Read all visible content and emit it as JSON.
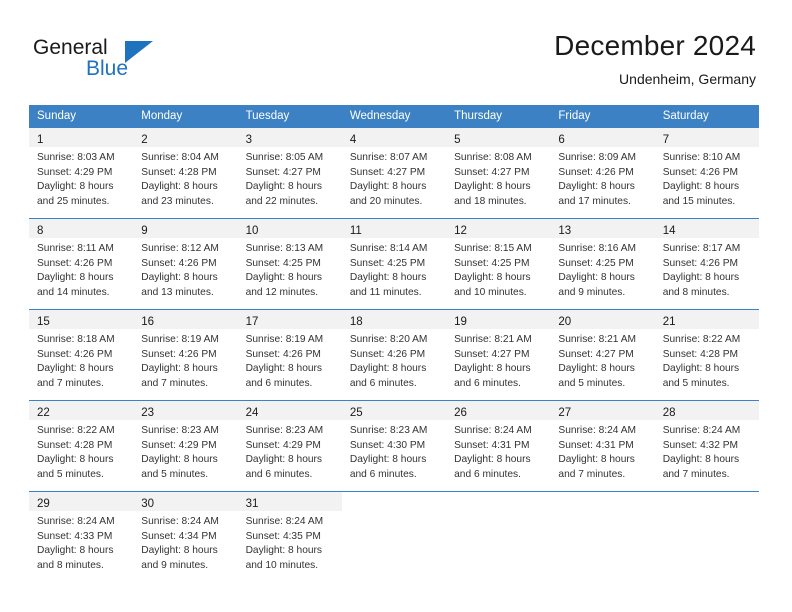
{
  "brand": {
    "name_part1": "General",
    "name_part2": "Blue",
    "accent_color": "#1f72bd"
  },
  "header": {
    "title": "December 2024",
    "location": "Undenheim, Germany"
  },
  "theme": {
    "header_row_color": "#3c81c4",
    "daynum_band_color": "#f2f2f2",
    "separator_color": "#3c81c4"
  },
  "weekday_headers": [
    "Sunday",
    "Monday",
    "Tuesday",
    "Wednesday",
    "Thursday",
    "Friday",
    "Saturday"
  ],
  "weeks": [
    [
      {
        "day": "1",
        "sunrise": "Sunrise: 8:03 AM",
        "sunset": "Sunset: 4:29 PM",
        "daylight1": "Daylight: 8 hours",
        "daylight2": "and 25 minutes."
      },
      {
        "day": "2",
        "sunrise": "Sunrise: 8:04 AM",
        "sunset": "Sunset: 4:28 PM",
        "daylight1": "Daylight: 8 hours",
        "daylight2": "and 23 minutes."
      },
      {
        "day": "3",
        "sunrise": "Sunrise: 8:05 AM",
        "sunset": "Sunset: 4:27 PM",
        "daylight1": "Daylight: 8 hours",
        "daylight2": "and 22 minutes."
      },
      {
        "day": "4",
        "sunrise": "Sunrise: 8:07 AM",
        "sunset": "Sunset: 4:27 PM",
        "daylight1": "Daylight: 8 hours",
        "daylight2": "and 20 minutes."
      },
      {
        "day": "5",
        "sunrise": "Sunrise: 8:08 AM",
        "sunset": "Sunset: 4:27 PM",
        "daylight1": "Daylight: 8 hours",
        "daylight2": "and 18 minutes."
      },
      {
        "day": "6",
        "sunrise": "Sunrise: 8:09 AM",
        "sunset": "Sunset: 4:26 PM",
        "daylight1": "Daylight: 8 hours",
        "daylight2": "and 17 minutes."
      },
      {
        "day": "7",
        "sunrise": "Sunrise: 8:10 AM",
        "sunset": "Sunset: 4:26 PM",
        "daylight1": "Daylight: 8 hours",
        "daylight2": "and 15 minutes."
      }
    ],
    [
      {
        "day": "8",
        "sunrise": "Sunrise: 8:11 AM",
        "sunset": "Sunset: 4:26 PM",
        "daylight1": "Daylight: 8 hours",
        "daylight2": "and 14 minutes."
      },
      {
        "day": "9",
        "sunrise": "Sunrise: 8:12 AM",
        "sunset": "Sunset: 4:26 PM",
        "daylight1": "Daylight: 8 hours",
        "daylight2": "and 13 minutes."
      },
      {
        "day": "10",
        "sunrise": "Sunrise: 8:13 AM",
        "sunset": "Sunset: 4:25 PM",
        "daylight1": "Daylight: 8 hours",
        "daylight2": "and 12 minutes."
      },
      {
        "day": "11",
        "sunrise": "Sunrise: 8:14 AM",
        "sunset": "Sunset: 4:25 PM",
        "daylight1": "Daylight: 8 hours",
        "daylight2": "and 11 minutes."
      },
      {
        "day": "12",
        "sunrise": "Sunrise: 8:15 AM",
        "sunset": "Sunset: 4:25 PM",
        "daylight1": "Daylight: 8 hours",
        "daylight2": "and 10 minutes."
      },
      {
        "day": "13",
        "sunrise": "Sunrise: 8:16 AM",
        "sunset": "Sunset: 4:25 PM",
        "daylight1": "Daylight: 8 hours",
        "daylight2": "and 9 minutes."
      },
      {
        "day": "14",
        "sunrise": "Sunrise: 8:17 AM",
        "sunset": "Sunset: 4:26 PM",
        "daylight1": "Daylight: 8 hours",
        "daylight2": "and 8 minutes."
      }
    ],
    [
      {
        "day": "15",
        "sunrise": "Sunrise: 8:18 AM",
        "sunset": "Sunset: 4:26 PM",
        "daylight1": "Daylight: 8 hours",
        "daylight2": "and 7 minutes."
      },
      {
        "day": "16",
        "sunrise": "Sunrise: 8:19 AM",
        "sunset": "Sunset: 4:26 PM",
        "daylight1": "Daylight: 8 hours",
        "daylight2": "and 7 minutes."
      },
      {
        "day": "17",
        "sunrise": "Sunrise: 8:19 AM",
        "sunset": "Sunset: 4:26 PM",
        "daylight1": "Daylight: 8 hours",
        "daylight2": "and 6 minutes."
      },
      {
        "day": "18",
        "sunrise": "Sunrise: 8:20 AM",
        "sunset": "Sunset: 4:26 PM",
        "daylight1": "Daylight: 8 hours",
        "daylight2": "and 6 minutes."
      },
      {
        "day": "19",
        "sunrise": "Sunrise: 8:21 AM",
        "sunset": "Sunset: 4:27 PM",
        "daylight1": "Daylight: 8 hours",
        "daylight2": "and 6 minutes."
      },
      {
        "day": "20",
        "sunrise": "Sunrise: 8:21 AM",
        "sunset": "Sunset: 4:27 PM",
        "daylight1": "Daylight: 8 hours",
        "daylight2": "and 5 minutes."
      },
      {
        "day": "21",
        "sunrise": "Sunrise: 8:22 AM",
        "sunset": "Sunset: 4:28 PM",
        "daylight1": "Daylight: 8 hours",
        "daylight2": "and 5 minutes."
      }
    ],
    [
      {
        "day": "22",
        "sunrise": "Sunrise: 8:22 AM",
        "sunset": "Sunset: 4:28 PM",
        "daylight1": "Daylight: 8 hours",
        "daylight2": "and 5 minutes."
      },
      {
        "day": "23",
        "sunrise": "Sunrise: 8:23 AM",
        "sunset": "Sunset: 4:29 PM",
        "daylight1": "Daylight: 8 hours",
        "daylight2": "and 5 minutes."
      },
      {
        "day": "24",
        "sunrise": "Sunrise: 8:23 AM",
        "sunset": "Sunset: 4:29 PM",
        "daylight1": "Daylight: 8 hours",
        "daylight2": "and 6 minutes."
      },
      {
        "day": "25",
        "sunrise": "Sunrise: 8:23 AM",
        "sunset": "Sunset: 4:30 PM",
        "daylight1": "Daylight: 8 hours",
        "daylight2": "and 6 minutes."
      },
      {
        "day": "26",
        "sunrise": "Sunrise: 8:24 AM",
        "sunset": "Sunset: 4:31 PM",
        "daylight1": "Daylight: 8 hours",
        "daylight2": "and 6 minutes."
      },
      {
        "day": "27",
        "sunrise": "Sunrise: 8:24 AM",
        "sunset": "Sunset: 4:31 PM",
        "daylight1": "Daylight: 8 hours",
        "daylight2": "and 7 minutes."
      },
      {
        "day": "28",
        "sunrise": "Sunrise: 8:24 AM",
        "sunset": "Sunset: 4:32 PM",
        "daylight1": "Daylight: 8 hours",
        "daylight2": "and 7 minutes."
      }
    ],
    [
      {
        "day": "29",
        "sunrise": "Sunrise: 8:24 AM",
        "sunset": "Sunset: 4:33 PM",
        "daylight1": "Daylight: 8 hours",
        "daylight2": "and 8 minutes."
      },
      {
        "day": "30",
        "sunrise": "Sunrise: 8:24 AM",
        "sunset": "Sunset: 4:34 PM",
        "daylight1": "Daylight: 8 hours",
        "daylight2": "and 9 minutes."
      },
      {
        "day": "31",
        "sunrise": "Sunrise: 8:24 AM",
        "sunset": "Sunset: 4:35 PM",
        "daylight1": "Daylight: 8 hours",
        "daylight2": "and 10 minutes."
      },
      {
        "day": "",
        "sunrise": "",
        "sunset": "",
        "daylight1": "",
        "daylight2": ""
      },
      {
        "day": "",
        "sunrise": "",
        "sunset": "",
        "daylight1": "",
        "daylight2": ""
      },
      {
        "day": "",
        "sunrise": "",
        "sunset": "",
        "daylight1": "",
        "daylight2": ""
      },
      {
        "day": "",
        "sunrise": "",
        "sunset": "",
        "daylight1": "",
        "daylight2": ""
      }
    ]
  ]
}
